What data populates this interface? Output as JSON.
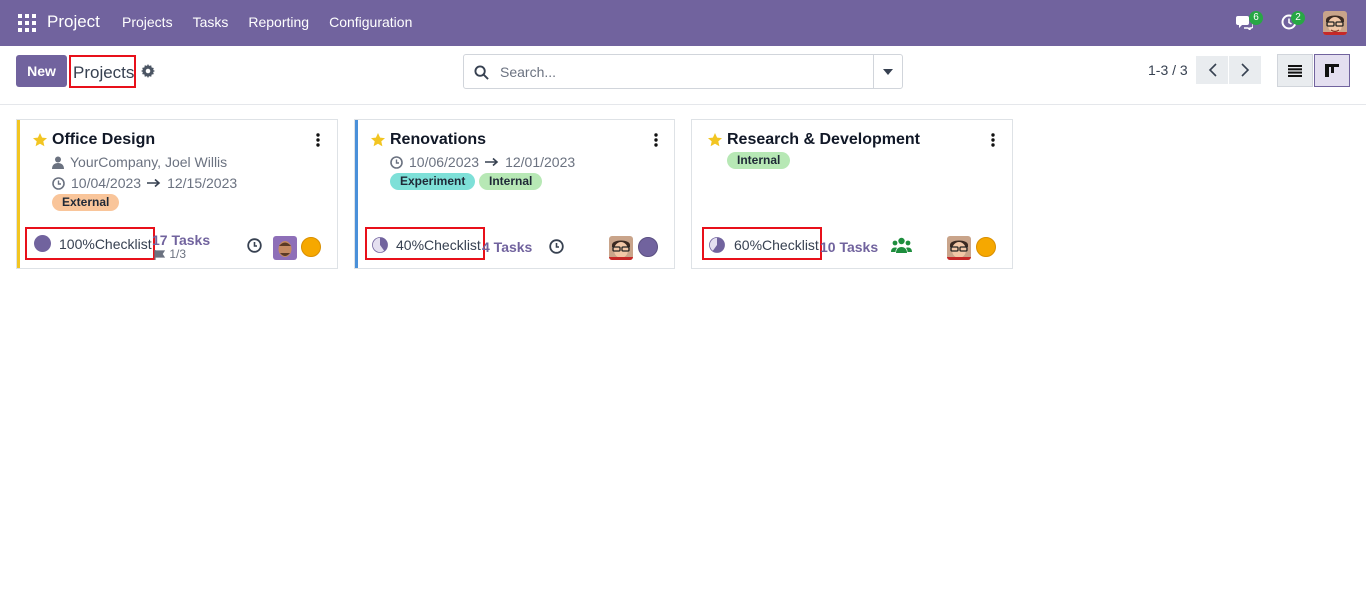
{
  "navbar": {
    "brand": "Project",
    "menu": [
      "Projects",
      "Tasks",
      "Reporting",
      "Configuration"
    ],
    "messages_count": "6",
    "activities_count": "2"
  },
  "control": {
    "new_label": "New",
    "title": "Projects",
    "search_placeholder": "Search...",
    "pager": "1-3 / 3"
  },
  "cards": [
    {
      "title": "Office Design",
      "customer": "YourCompany, Joel Willis",
      "date_start": "10/04/2023",
      "date_end": "12/15/2023",
      "tags": [
        "External"
      ],
      "checklist_percent": "100%",
      "checklist_label": "Checklist",
      "tasks": "17 Tasks",
      "milestones": "1/3"
    },
    {
      "title": "Renovations",
      "date_start": "10/06/2023",
      "date_end": "12/01/2023",
      "tags": [
        "Experiment",
        "Internal"
      ],
      "checklist_percent": "40%",
      "checklist_label": "Checklist",
      "tasks": "4 Tasks"
    },
    {
      "title": "Research & Development",
      "tags": [
        "Internal"
      ],
      "checklist_percent": "60%",
      "checklist_label": "Checklist",
      "tasks": "10 Tasks"
    }
  ],
  "colors": {
    "navbar": "#71639e",
    "highlight": "#e8101a",
    "tag_external": "#f9c59a",
    "tag_experiment": "#7ee0d8",
    "tag_internal": "#b7e8b5",
    "band_office": "#f2c522",
    "band_renovations": "#4a90d9",
    "status_orange": "#f6a800",
    "status_purple": "#71639e"
  }
}
